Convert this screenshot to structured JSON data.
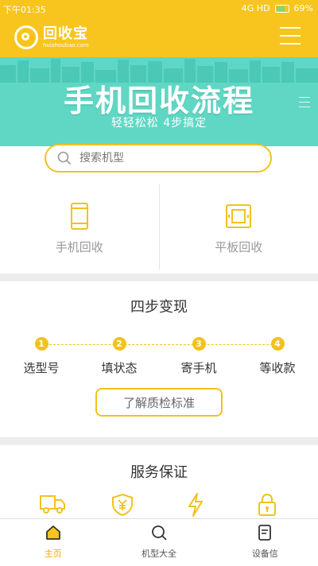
{
  "status_bar": {
    "time": "下午01:35",
    "network": "4G HD",
    "battery": "69%"
  },
  "header": {
    "logo_title": "回收宝",
    "logo_sub": "huishoubao.com",
    "menu_icon": "hamburger-icon"
  },
  "banner": {
    "title": "手机回收流程",
    "subtitle": "轻轻松松  4步搞定"
  },
  "search": {
    "placeholder": "搜索机型"
  },
  "categories": [
    {
      "label": "手机回收",
      "icon": "phone-icon"
    },
    {
      "label": "平板回收",
      "icon": "tablet-icon"
    }
  ],
  "steps": {
    "title": "四步变现",
    "items": [
      {
        "num": "1",
        "label": "选型号"
      },
      {
        "num": "2",
        "label": "填状态"
      },
      {
        "num": "3",
        "label": "寄手机"
      },
      {
        "num": "4",
        "label": "等收款"
      }
    ],
    "button_label": "了解质检标准"
  },
  "service": {
    "title": "服务保证",
    "icons": [
      "truck-icon",
      "yuan-shield-icon",
      "lightning-icon",
      "lock-icon"
    ]
  },
  "bottom_nav": [
    {
      "label": "主页",
      "icon": "home-icon",
      "active": true
    },
    {
      "label": "机型大全",
      "icon": "search-icon",
      "active": false
    },
    {
      "label": "设备信",
      "icon": "document-icon",
      "active": false
    }
  ],
  "colors": {
    "brand_yellow": "#f7c51d",
    "banner_teal": "#5fd7c4",
    "accent_orange": "#f2a50c"
  }
}
